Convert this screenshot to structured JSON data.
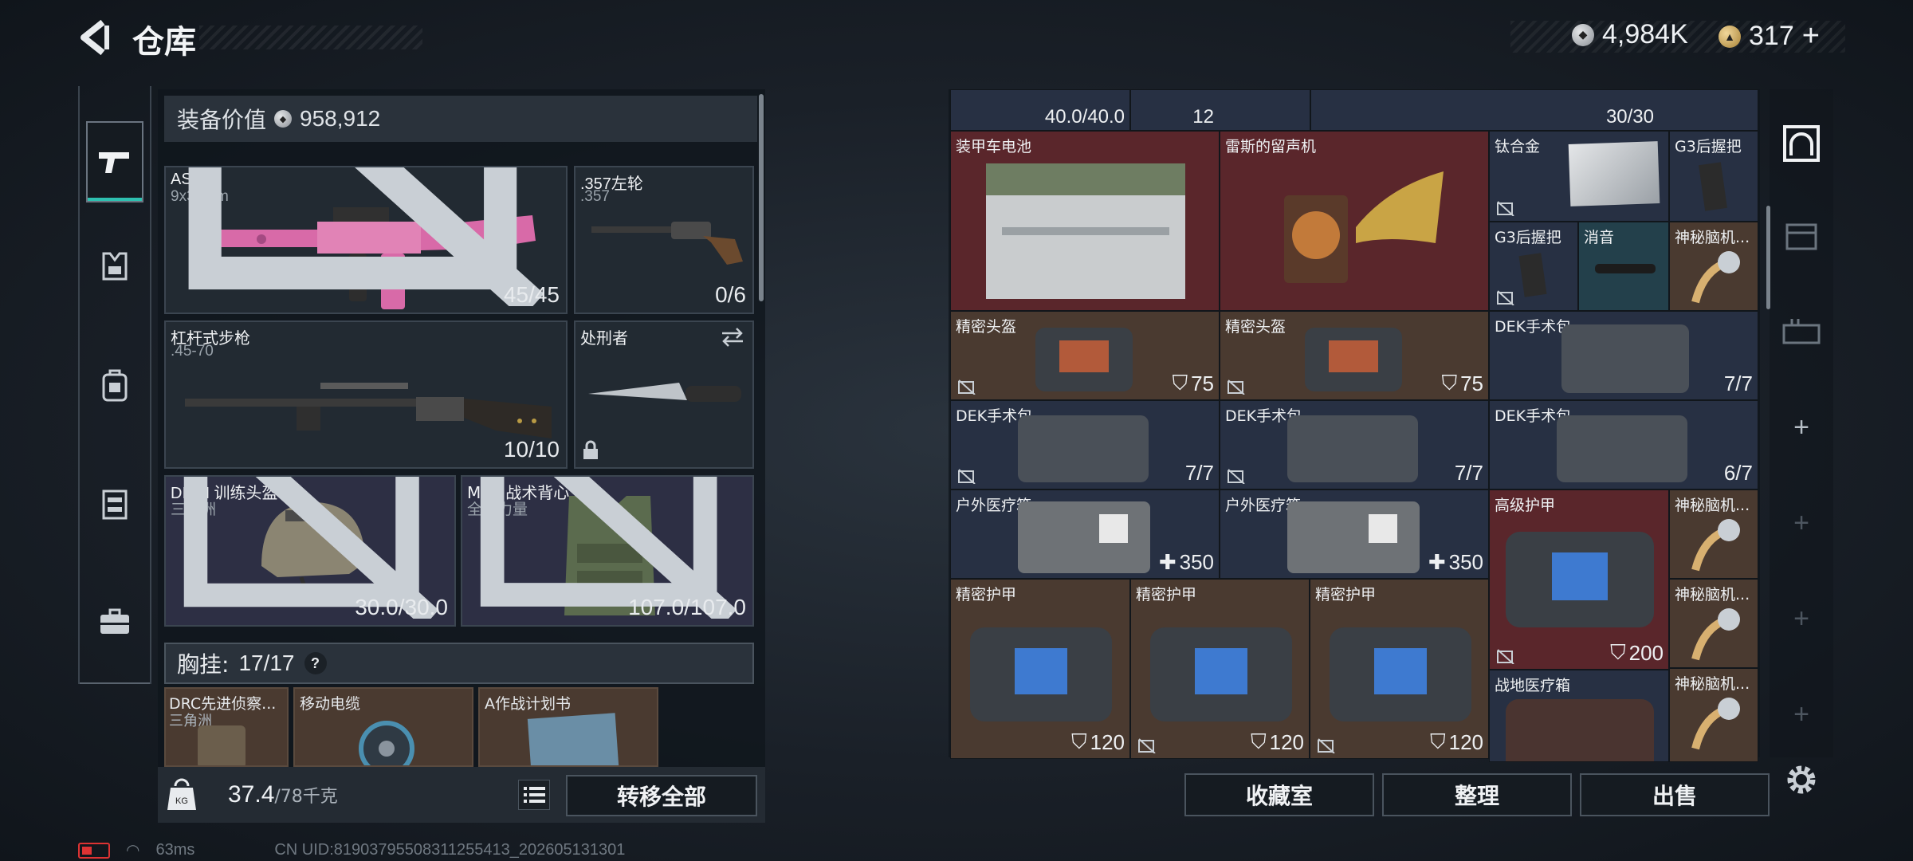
{
  "header": {
    "title": "仓库",
    "currency": [
      {
        "value": "4,984K",
        "icon": "silver-coin-icon"
      },
      {
        "value": "317",
        "icon": "gold-coin-icon",
        "suffix": "+"
      }
    ]
  },
  "left_nav": {
    "tabs": [
      {
        "icon": "gun-icon",
        "active": true
      },
      {
        "icon": "vest-icon"
      },
      {
        "icon": "backpack-icon"
      },
      {
        "icon": "chest-rig-icon"
      },
      {
        "icon": "case-icon"
      }
    ]
  },
  "equipment": {
    "value_label": "装备价值",
    "value": "958,912",
    "slots": {
      "primary1": {
        "name": "AS Val",
        "sub": "9x39mm",
        "value": "45/45"
      },
      "pistol": {
        "name": ".357左轮",
        "sub": ".357",
        "value": "0/6"
      },
      "primary2": {
        "name": "杠杆式步枪",
        "sub": ".45-70",
        "value": "10/10"
      },
      "melee": {
        "name": "处刑者"
      },
      "helmet": {
        "name": "DICH 训练头盔",
        "sub": "三角洲",
        "value": "30.0/30.0"
      },
      "armor": {
        "name": "MK-2战术背心",
        "sub": "全球力量",
        "value": "107.0/107.0"
      }
    },
    "chest_rig": {
      "label": "胸挂:",
      "capacity": "17/17",
      "help": "?"
    },
    "chest_items": [
      {
        "name": "DRC先进侦察...",
        "sub": "三角洲"
      },
      {
        "name": "移动电缆"
      },
      {
        "name": "A作战计划书"
      }
    ],
    "weight": {
      "current": "37.4",
      "max": "/78千克"
    },
    "transfer_all": "转移全部"
  },
  "storage": {
    "top_row": [
      {
        "value": "40.0/40.0"
      },
      {
        "value": "12"
      },
      {
        "value": "30/30"
      }
    ],
    "cells": [
      {
        "name": "装甲车电池"
      },
      {
        "name": "雷斯的留声机"
      },
      {
        "name": "钛合金"
      },
      {
        "name": "G3后握把"
      },
      {
        "name": "G3后握把"
      },
      {
        "name": "消音"
      },
      {
        "name": "神秘脑机..."
      },
      {
        "name": "精密头盔",
        "value": "75"
      },
      {
        "name": "精密头盔",
        "value": "75"
      },
      {
        "name": "DEK手术包",
        "value": "7/7"
      },
      {
        "name": "DEK手术包",
        "value": "7/7"
      },
      {
        "name": "DEK手术包",
        "value": "7/7"
      },
      {
        "name": "DEK手术包",
        "value": "6/7"
      },
      {
        "name": "户外医疗箱",
        "value": "350"
      },
      {
        "name": "户外医疗箱",
        "value": "350"
      },
      {
        "name": "高级护甲",
        "value": "200"
      },
      {
        "name": "神秘脑机..."
      },
      {
        "name": "精密护甲",
        "value": "120"
      },
      {
        "name": "精密护甲",
        "value": "120"
      },
      {
        "name": "精密护甲",
        "value": "120"
      },
      {
        "name": "神秘脑机..."
      },
      {
        "name": "战地医疗箱"
      },
      {
        "name": "神秘脑机..."
      }
    ]
  },
  "bottom_actions": {
    "collection": "收藏室",
    "organize": "整理",
    "sell": "出售"
  },
  "status": {
    "ping": "63ms",
    "uid": "CN UID:81903795508311255413_202605131301"
  }
}
